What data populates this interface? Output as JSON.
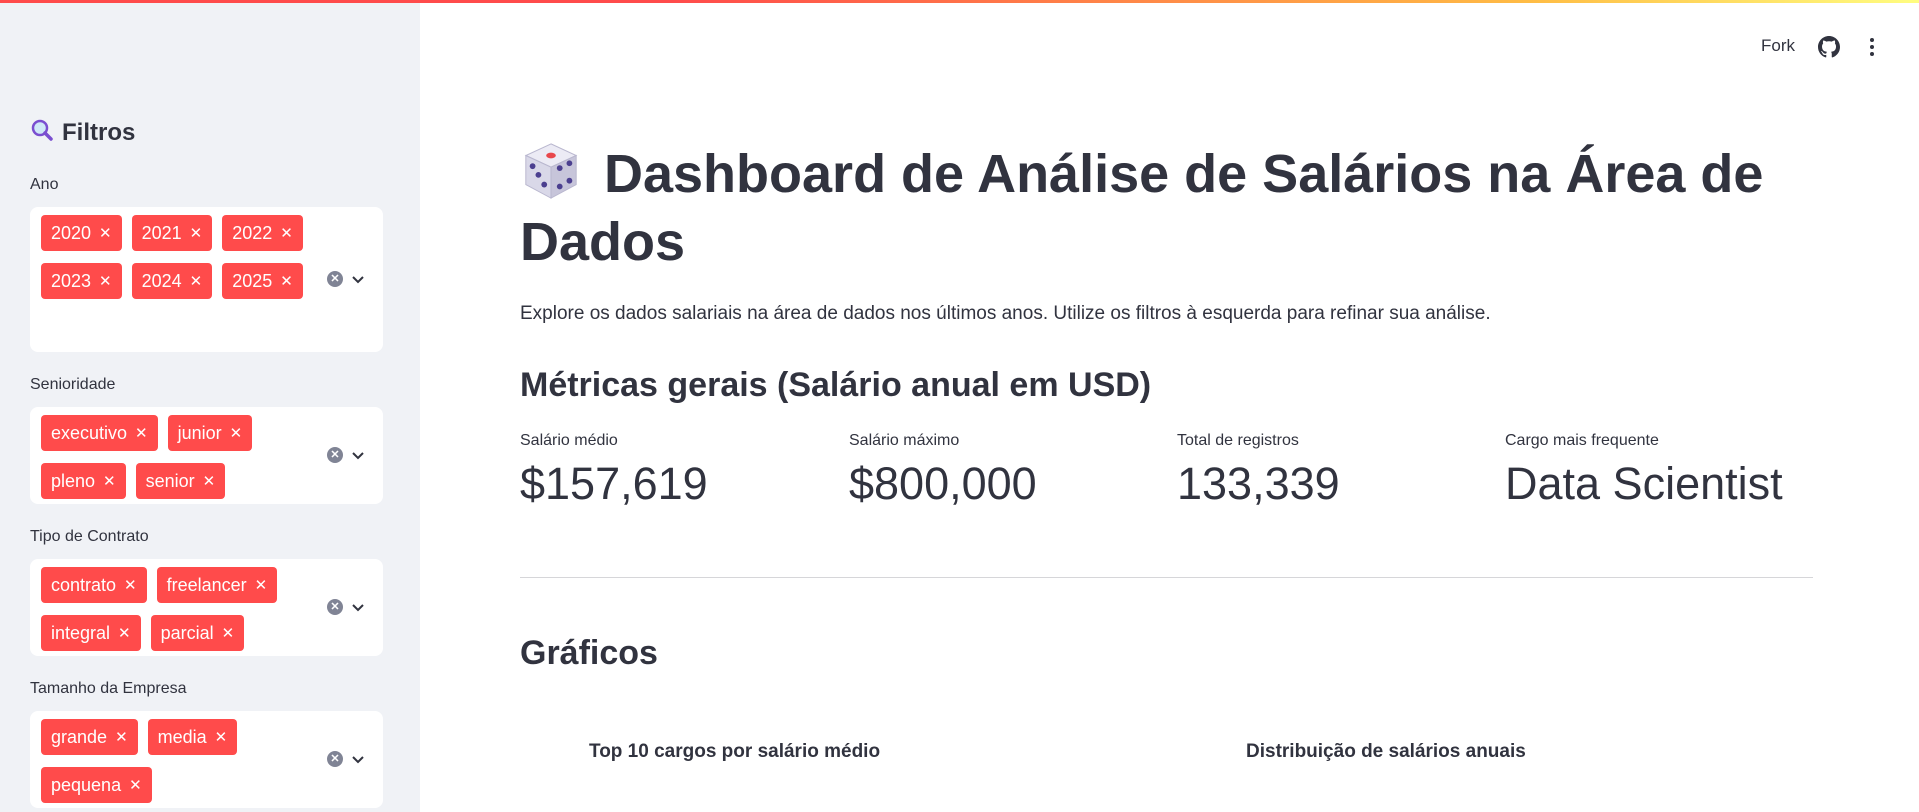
{
  "header": {
    "fork_label": "Fork"
  },
  "sidebar": {
    "title": "Filtros",
    "filters": [
      {
        "label": "Ano",
        "selected": [
          "2020",
          "2021",
          "2022",
          "2023",
          "2024",
          "2025"
        ]
      },
      {
        "label": "Senioridade",
        "selected": [
          "executivo",
          "junior",
          "pleno",
          "senior"
        ]
      },
      {
        "label": "Tipo de Contrato",
        "selected": [
          "contrato",
          "freelancer",
          "integral",
          "parcial"
        ]
      },
      {
        "label": "Tamanho da Empresa",
        "selected": [
          "grande",
          "media",
          "pequena"
        ]
      }
    ]
  },
  "main": {
    "title": "Dashboard de Análise de Salários na Área de Dados",
    "subtitle": "Explore os dados salariais na área de dados nos últimos anos. Utilize os filtros à esquerda para refinar sua análise.",
    "metrics_header": "Métricas gerais (Salário anual em USD)",
    "metrics": [
      {
        "label": "Salário médio",
        "value": "$157,619"
      },
      {
        "label": "Salário máximo",
        "value": "$800,000"
      },
      {
        "label": "Total de registros",
        "value": "133,339"
      },
      {
        "label": "Cargo mais frequente",
        "value": "Data Scientist"
      }
    ],
    "charts_header": "Gráficos",
    "chart_titles": [
      "Top 10 cargos por salário médio",
      "Distribuição de salários anuais"
    ]
  },
  "colors": {
    "accent": "#ff4b4b",
    "sidebar_bg": "#f0f2f6",
    "text": "#31333f"
  },
  "icons": {
    "sidebar_title": "magnifier-icon",
    "title": "dice-icon",
    "github": "github-icon",
    "menu": "kebab-menu-icon"
  }
}
